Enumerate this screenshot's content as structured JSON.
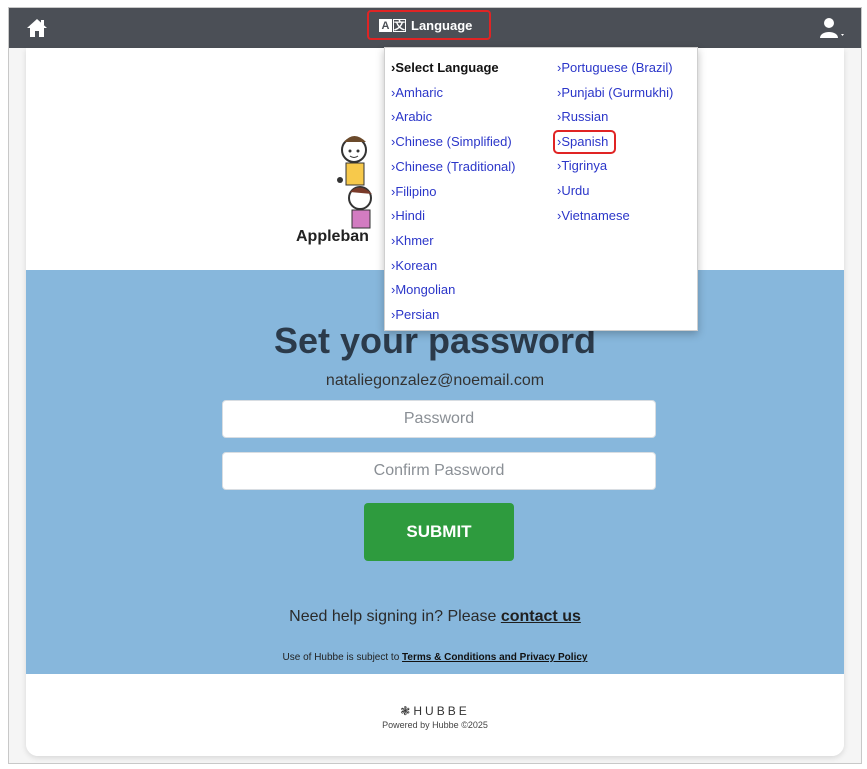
{
  "topbar": {
    "home_icon": "home-icon",
    "language_label": "Language",
    "language_icon": "translate-icon",
    "user_icon": "user-icon"
  },
  "language_menu": {
    "column1": [
      "›Select Language",
      "›Amharic",
      "›Arabic",
      "›Chinese (Simplified)",
      "›Chinese (Traditional)",
      "›Filipino",
      "›Hindi",
      "›Khmer",
      "›Korean",
      "›Mongolian",
      "›Persian"
    ],
    "column2": [
      "›Portuguese (Brazil)",
      "›Punjabi (Gurmukhi)",
      "›Russian",
      "›Spanish",
      "›Tigrinya",
      "›Urdu",
      "›Vietnamese"
    ],
    "highlighted": "›Spanish"
  },
  "logo": {
    "text": "Appleban"
  },
  "form": {
    "title": "Set your password",
    "email": "nataliegonzalez@noemail.com",
    "password_placeholder": "Password",
    "confirm_placeholder": "Confirm Password",
    "submit_label": "SUBMIT"
  },
  "help": {
    "prefix": "Need help signing in? Please ",
    "link": "contact us"
  },
  "terms": {
    "prefix": "Use of Hubbe is subject to ",
    "link": "Terms & Conditions and Privacy Policy"
  },
  "footer": {
    "brand": "HUBBE",
    "powered": "Powered by Hubbe ©2025"
  },
  "colors": {
    "topbar": "#4b4f56",
    "blue_section": "#87b7dc",
    "submit": "#2e9b3e",
    "highlight_border": "#e02424",
    "menu_link": "#2b36c9"
  }
}
